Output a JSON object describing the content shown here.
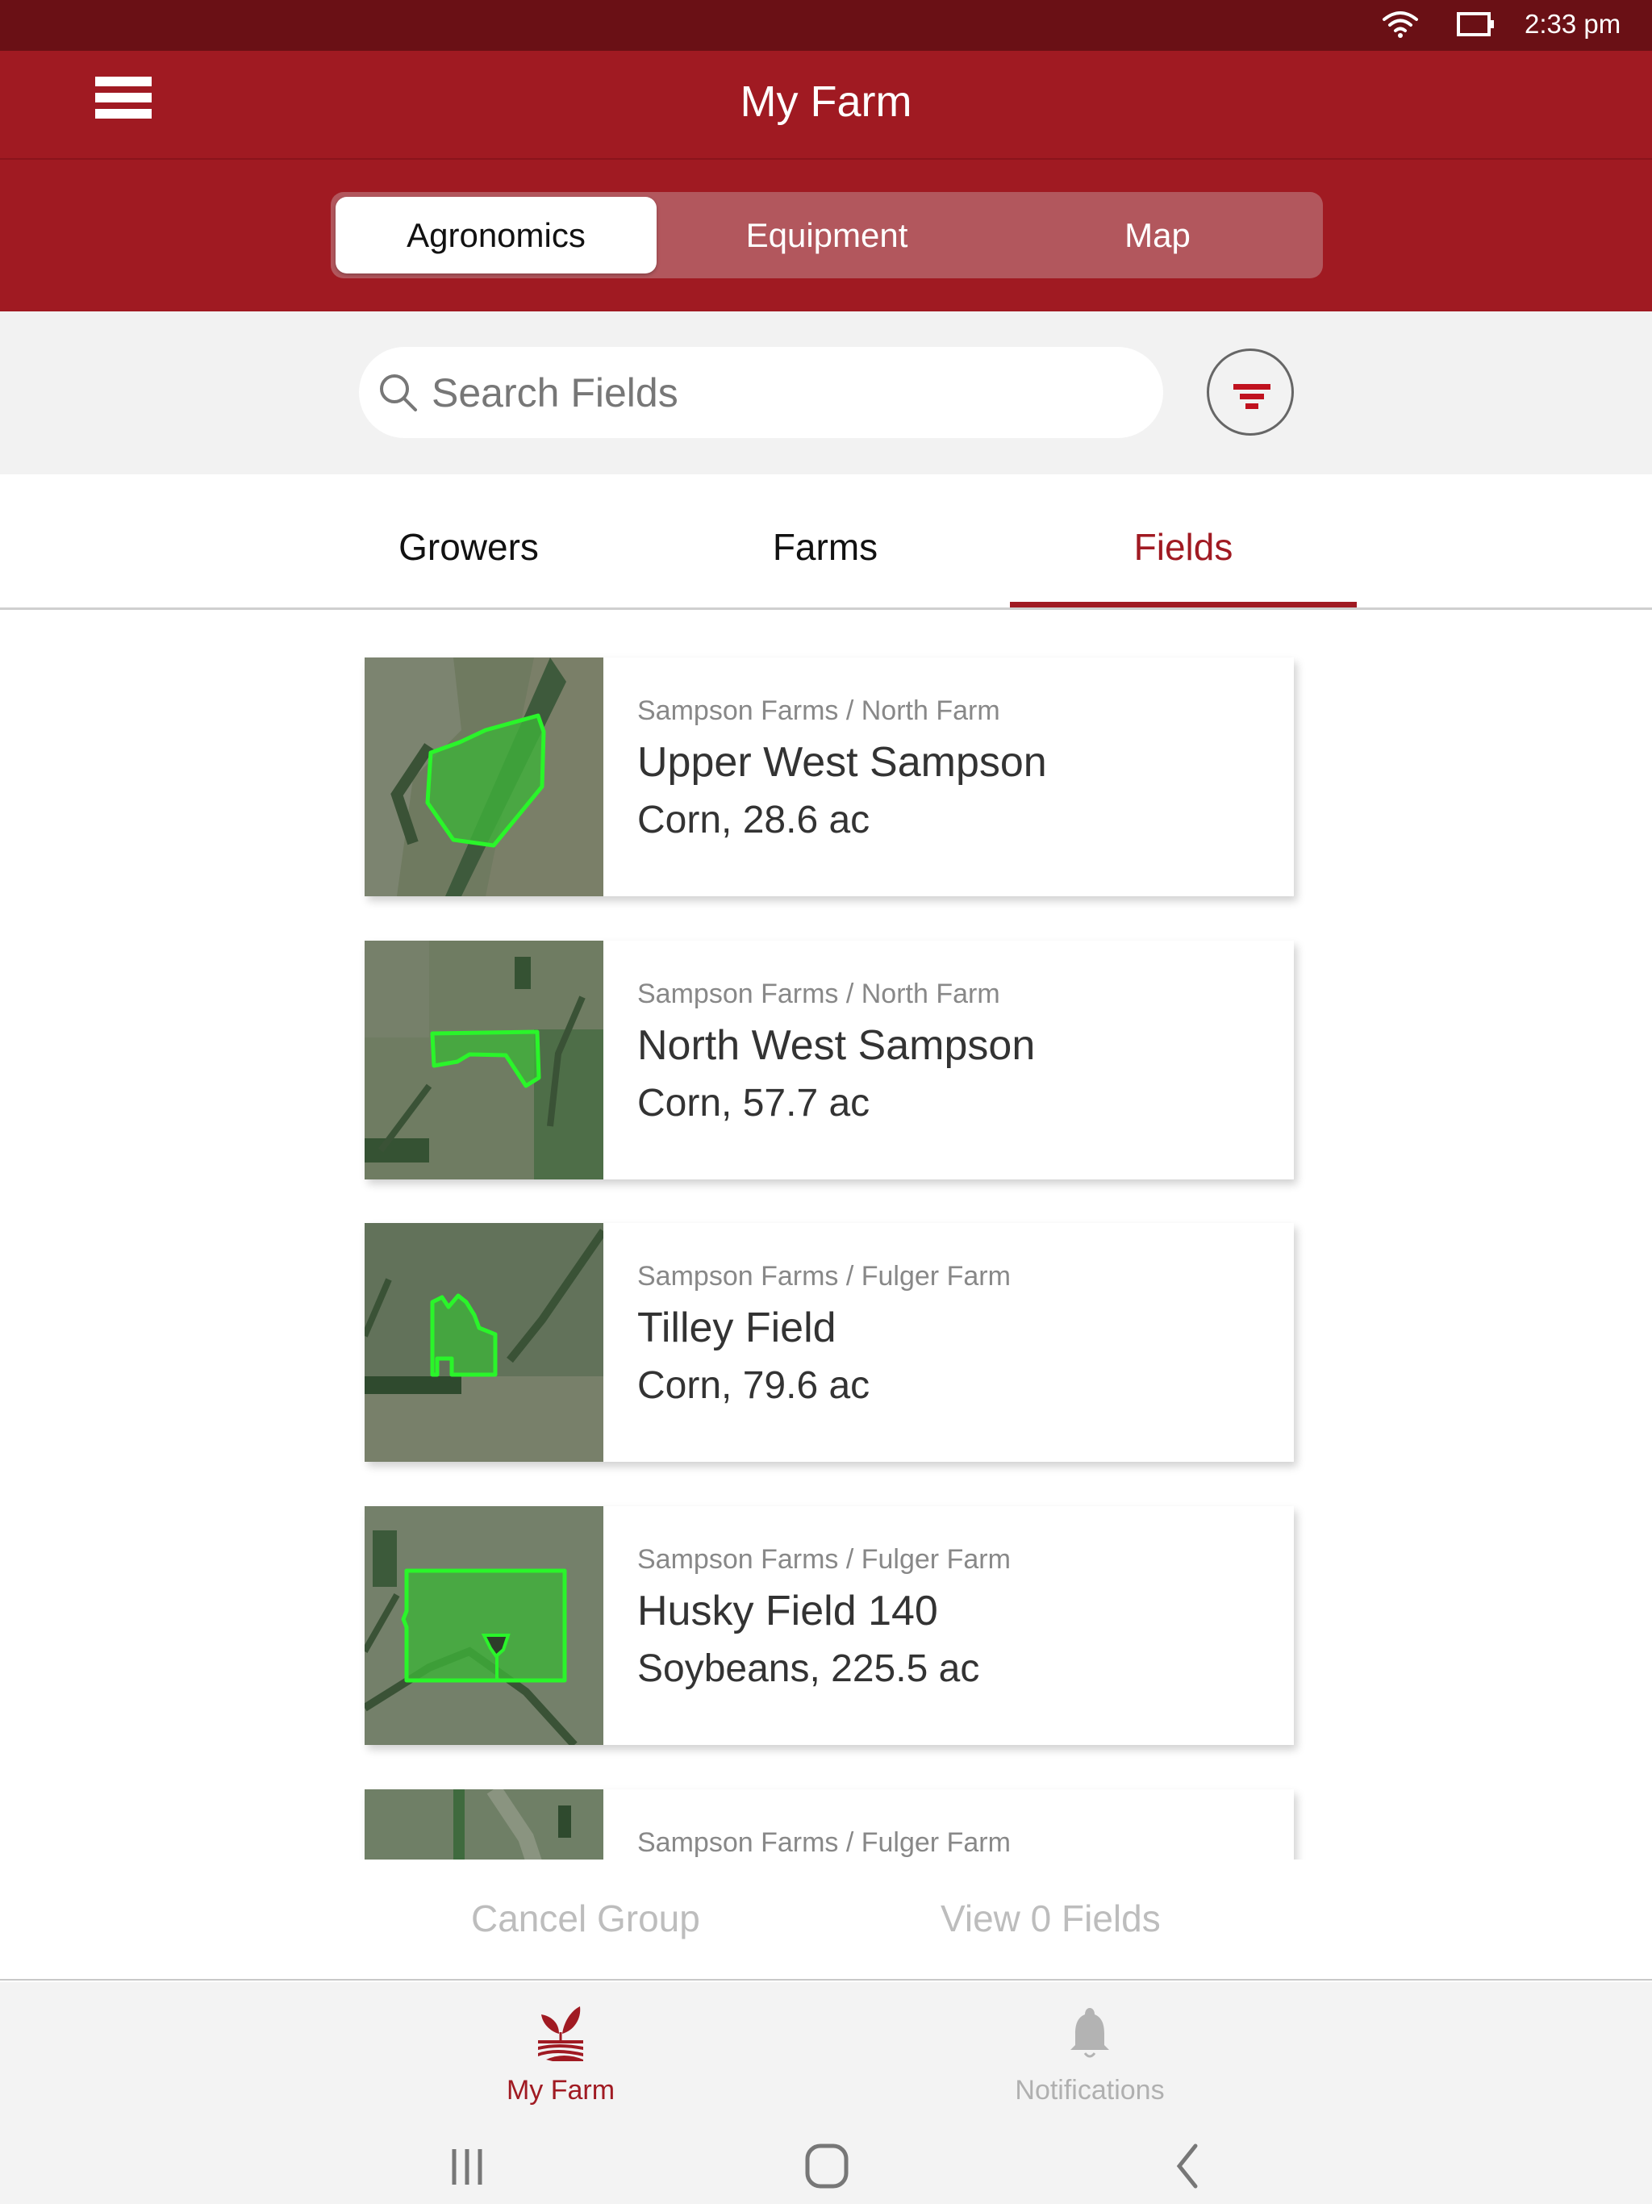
{
  "status_bar": {
    "wifi_icon": "wifi-icon",
    "battery_icon": "battery-icon",
    "time": "2:33 pm"
  },
  "header": {
    "menu_icon": "hamburger-menu-icon",
    "title": "My Farm"
  },
  "segments": {
    "items": [
      {
        "label": "Agronomics",
        "active": true
      },
      {
        "label": "Equipment",
        "active": false
      },
      {
        "label": "Map",
        "active": false
      }
    ]
  },
  "search": {
    "placeholder": "Search Fields",
    "value": "",
    "icon": "search-icon",
    "filter_icon": "filter-icon"
  },
  "tabs": {
    "items": [
      {
        "label": "Growers",
        "active": false
      },
      {
        "label": "Farms",
        "active": false
      },
      {
        "label": "Fields",
        "active": true
      }
    ]
  },
  "fields": [
    {
      "path": "Sampson Farms / North Farm",
      "name": "Upper West Sampson",
      "detail": "Corn, 28.6 ac"
    },
    {
      "path": "Sampson Farms / North Farm",
      "name": "North West Sampson",
      "detail": "Corn, 57.7 ac"
    },
    {
      "path": "Sampson Farms / Fulger Farm",
      "name": "Tilley Field",
      "detail": "Corn, 79.6 ac"
    },
    {
      "path": "Sampson Farms / Fulger Farm",
      "name": "Husky Field 140",
      "detail": "Soybeans, 225.5 ac"
    },
    {
      "path": "Sampson Farms / Fulger Farm",
      "name": "",
      "detail": ""
    }
  ],
  "actions": {
    "cancel_label": "Cancel Group",
    "view_label": "View 0 Fields"
  },
  "bottom_nav": {
    "items": [
      {
        "label": "My Farm",
        "icon": "farm-sprout-icon",
        "active": true
      },
      {
        "label": "Notifications",
        "icon": "bell-icon",
        "active": false
      }
    ]
  },
  "system_nav": {
    "recent_icon": "recent-apps-icon",
    "home_icon": "home-icon",
    "back_icon": "back-icon"
  },
  "colors": {
    "brand_red": "#a01a22",
    "status_bar": "#6a1015",
    "field_outline": "#2af52a",
    "filter_red": "#c0121f"
  }
}
